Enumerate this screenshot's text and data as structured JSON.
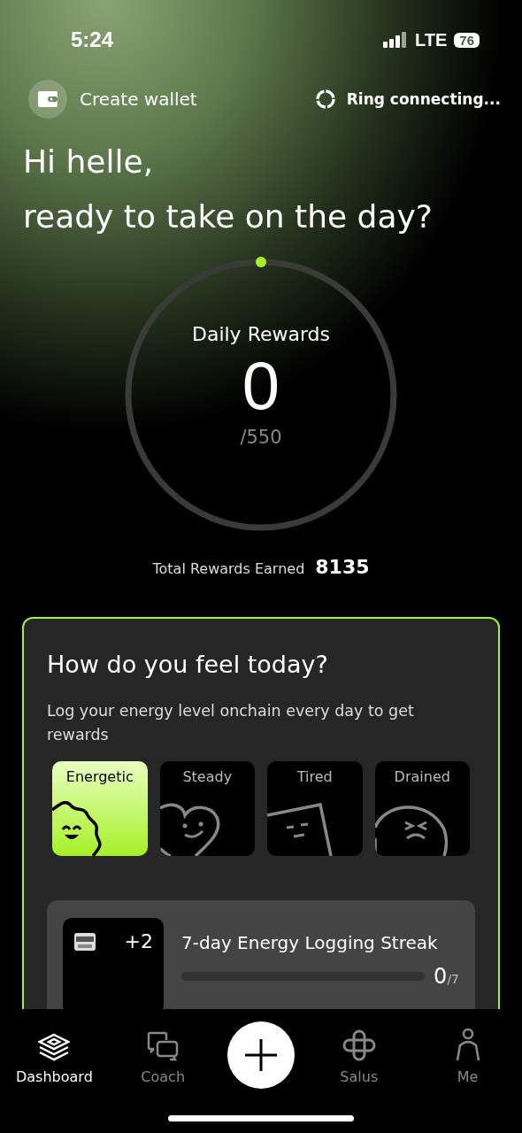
{
  "status_bar": {
    "time": "5:24",
    "network": "LTE",
    "battery": "76"
  },
  "header": {
    "wallet_label": "Create wallet",
    "ring_status": "Ring connecting..."
  },
  "greeting": {
    "line_1": "Hi helle,",
    "line_2": "ready to take on the day?"
  },
  "daily_rewards": {
    "title": "Daily Rewards",
    "value": "0",
    "goal": "/550"
  },
  "total_rewards": {
    "label": "Total Rewards Earned",
    "value": "8135"
  },
  "feel_card": {
    "title": "How do you feel today?",
    "subtitle": "Log your energy level onchain every day to get rewards",
    "moods": [
      {
        "label": "Energetic",
        "kind": "blob",
        "selected": true
      },
      {
        "label": "Steady",
        "kind": "heart",
        "selected": false
      },
      {
        "label": "Tired",
        "kind": "square",
        "selected": false
      },
      {
        "label": "Drained",
        "kind": "circle",
        "selected": false
      }
    ],
    "streak": {
      "bonus": "+2",
      "title": "7-day Energy Logging Streak",
      "progress": "0",
      "total": "/7",
      "level": 0
    }
  },
  "tab_bar": {
    "tabs": [
      {
        "label": "Dashboard",
        "kind": "layers",
        "selected": true
      },
      {
        "label": "Coach",
        "kind": "chat",
        "selected": false
      },
      {
        "kind": "add"
      },
      {
        "label": "Salus",
        "kind": "knot",
        "selected": false
      },
      {
        "label": "Me",
        "kind": "person",
        "selected": false
      }
    ]
  }
}
